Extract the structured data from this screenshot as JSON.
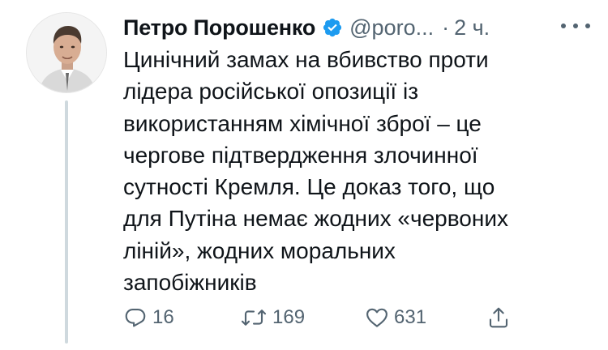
{
  "author": {
    "name": "Петро Порошенко",
    "handle": "@poro...",
    "separator": "·",
    "time": "2 ч."
  },
  "tweet": {
    "text": "Цинічний замах на вбивство проти\nлідера російської опозиції із\nвикористанням хімічної зброї – це\nчергове підтвердження злочинної\nсутності Кремля. Це доказ того, що\nдля Путіна немає жодних «червоних\nліній», жодних моральних\nзапобіжників"
  },
  "actions": {
    "replies": "16",
    "retweets": "169",
    "likes": "631"
  },
  "icons": {
    "verified": "verified-badge-icon",
    "more": "more-options-icon",
    "reply": "reply-icon",
    "retweet": "retweet-icon",
    "like": "heart-icon",
    "share": "share-icon"
  },
  "colors": {
    "verified": "#1d9bf0",
    "secondary_text": "#536471",
    "primary_text": "#0f1419",
    "thread_line": "#cfd9de"
  }
}
